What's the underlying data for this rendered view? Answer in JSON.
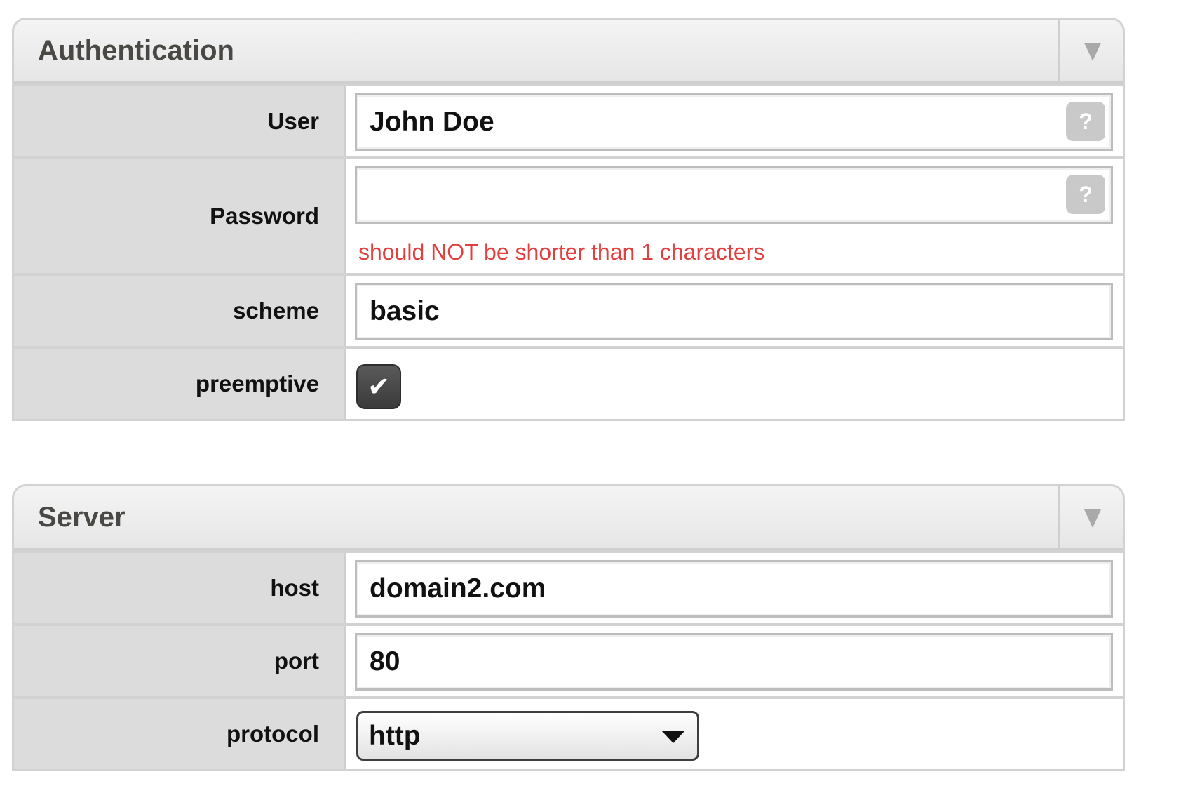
{
  "authentication": {
    "title": "Authentication",
    "user": {
      "label": "User",
      "value": "John Doe",
      "help": "?"
    },
    "password": {
      "label": "Password",
      "value": "",
      "help": "?",
      "error": "should NOT be shorter than 1 characters"
    },
    "scheme": {
      "label": "scheme",
      "value": "basic"
    },
    "preemptive": {
      "label": "preemptive",
      "checked": true,
      "mark": "✔"
    }
  },
  "server": {
    "title": "Server",
    "host": {
      "label": "host",
      "value": "domain2.com"
    },
    "port": {
      "label": "port",
      "value": "80"
    },
    "protocol": {
      "label": "protocol",
      "value": "http"
    }
  },
  "icons": {
    "collapse": "triangle-down-icon",
    "help": "question-icon",
    "check": "checkmark-icon",
    "dropdown": "chevron-down-icon"
  },
  "colors": {
    "error": "#e2403f",
    "label_bg": "#dcdcdc",
    "checkbox_bg": "#444444"
  }
}
